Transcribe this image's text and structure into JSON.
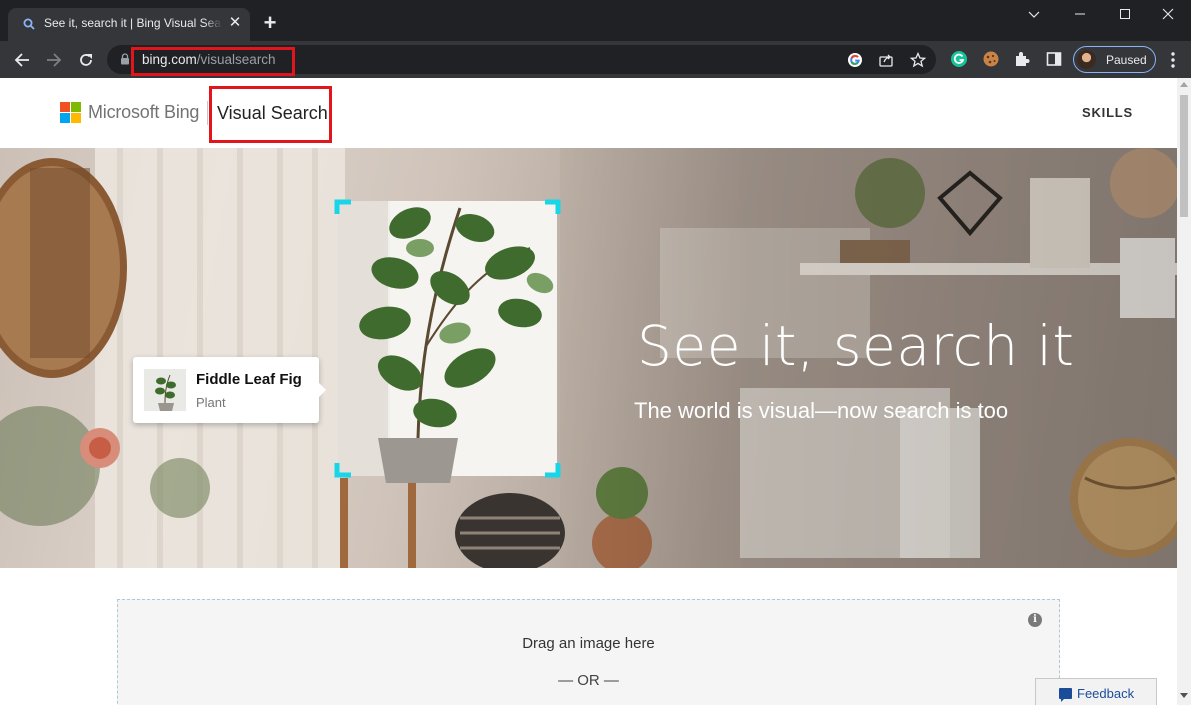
{
  "browser": {
    "tab": {
      "title": "See it, search it | Bing Visual Sear",
      "favicon": "search-icon"
    },
    "address": {
      "domain": "bing.com",
      "path": "/visualsearch"
    },
    "profile": {
      "label": "Paused"
    }
  },
  "header": {
    "brand": "Microsoft Bing",
    "product": "Visual Search",
    "nav": {
      "skills": "SKILLS"
    }
  },
  "hero": {
    "title": "See it, search it",
    "subtitle": "The world is visual—now search is too",
    "result_card": {
      "title": "Fiddle Leaf Fig",
      "subtitle": "Plant"
    },
    "frame_color": "#17d6e8"
  },
  "upload": {
    "drag_text": "Drag an image here",
    "or_text": "— OR —",
    "info_icon": "i"
  },
  "feedback": {
    "label": "Feedback"
  },
  "colors": {
    "highlight": "#e0161c",
    "ms_red": "#f25022",
    "ms_green": "#7fba00",
    "ms_blue": "#00a4ef",
    "ms_yellow": "#ffb900"
  }
}
